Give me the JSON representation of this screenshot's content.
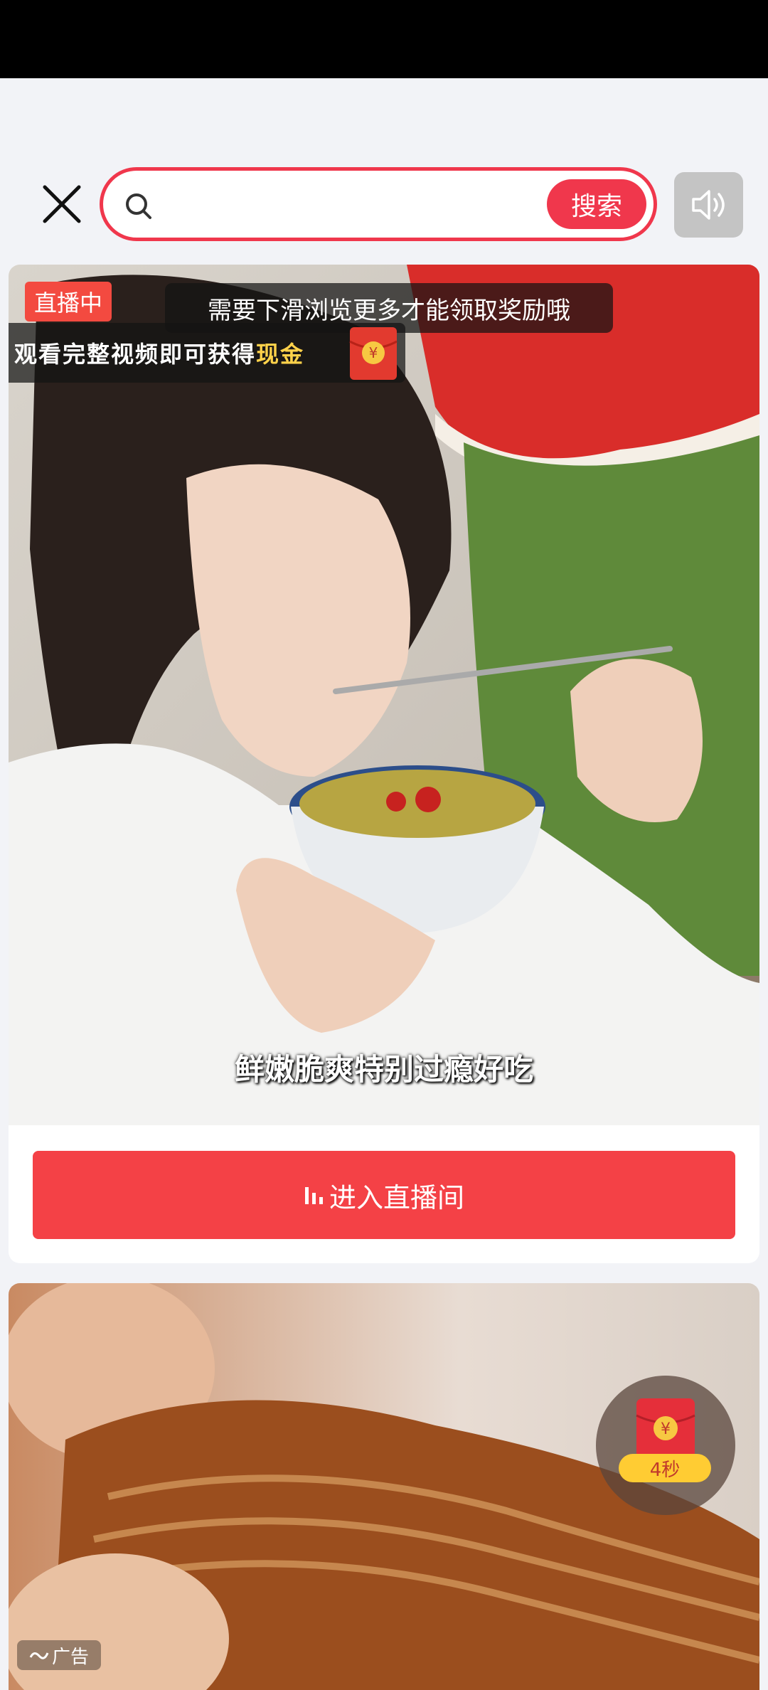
{
  "search": {
    "placeholder": "",
    "button_label": "搜索"
  },
  "live_card": {
    "badge": "直播中",
    "hint": "需要下滑浏览更多才能领取奖励哦",
    "reward_text": "观看完整视频即可获得",
    "reward_highlight": "现金",
    "subtitle": "鲜嫩脆爽特别过瘾好吃",
    "enter_button": "进入直播间"
  },
  "ad_card": {
    "tag": "广告"
  },
  "reward_timer": {
    "countdown": "4秒"
  },
  "colors": {
    "accent": "#f0374c",
    "enter_button": "#f44146",
    "gold": "#ffd24a"
  }
}
